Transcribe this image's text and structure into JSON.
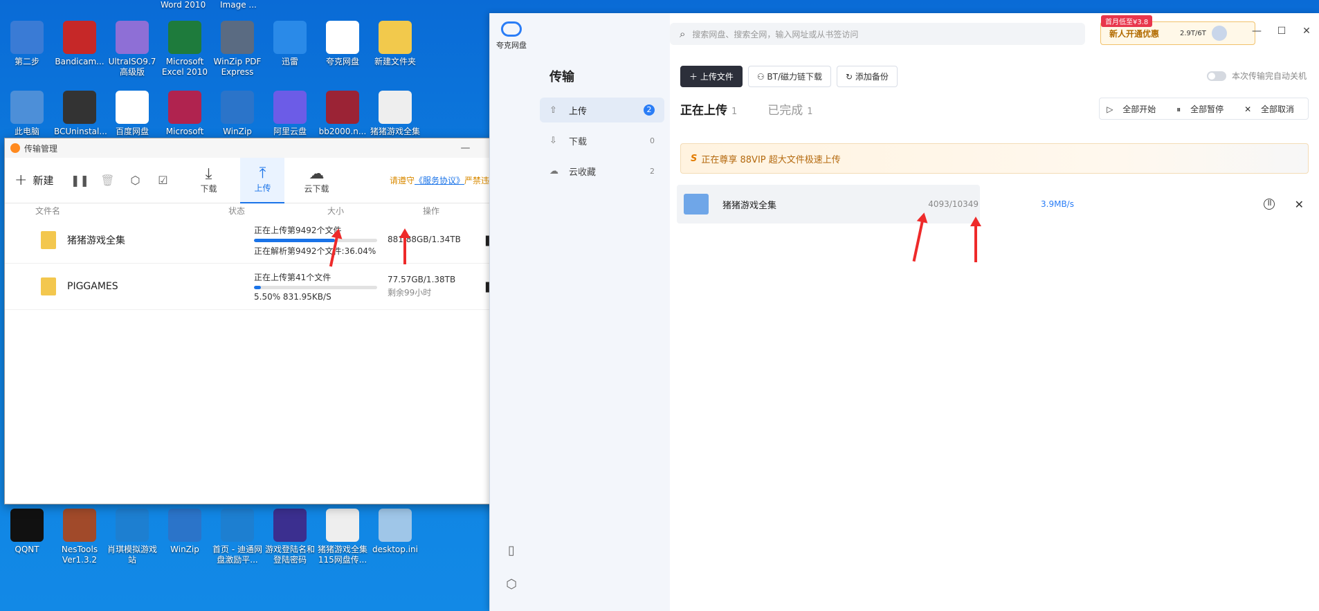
{
  "desktop": {
    "top_labels": [
      "Word 2010",
      "Image ..."
    ],
    "icons_row1": [
      {
        "label": "第二步",
        "color": "#3a7bd5"
      },
      {
        "label": "Bandicam...",
        "color": "#c62828"
      },
      {
        "label": "UltraISO9.7 高级版",
        "color": "#8e6fd6"
      },
      {
        "label": "Microsoft Excel 2010",
        "color": "#1e7b3c"
      },
      {
        "label": "WinZip PDF Express",
        "color": "#5a6b82"
      },
      {
        "label": "迅雷",
        "color": "#2a8ae8"
      },
      {
        "label": "夸克网盘",
        "color": "#ffffff"
      },
      {
        "label": "新建文件夹",
        "color": "#f2c94c"
      }
    ],
    "icons_row2": [
      {
        "label": "此电脑",
        "color": "#4d8fd8"
      },
      {
        "label": "BCUninstal...",
        "color": "#333333"
      },
      {
        "label": "百度网盘",
        "color": "#ffffff"
      },
      {
        "label": "Microsoft",
        "color": "#b0234f"
      },
      {
        "label": "WinZip",
        "color": "#2b74c9"
      },
      {
        "label": "阿里云盘",
        "color": "#6c5ce7"
      },
      {
        "label": "bb2000.n...",
        "color": "#9b2335"
      },
      {
        "label": "猪猪游戏全集",
        "color": "#eeeeee"
      }
    ],
    "icons_row3": [
      {
        "label": "QQNT",
        "color": "#111111"
      },
      {
        "label": "NesTools Ver1.3.2",
        "color": "#a14a2a"
      },
      {
        "label": "肖琪模拟游戏站",
        "color": "#1d7fd1"
      },
      {
        "label": "WinZip",
        "color": "#2b74c9"
      },
      {
        "label": "首页 - 迪通网盘激励平...",
        "color": "#1d7fd1"
      },
      {
        "label": "游戏登陆名和登陆密码",
        "color": "#3b2f8f"
      },
      {
        "label": "猪猪游戏全集115网盘传...",
        "color": "#eeeeee"
      },
      {
        "label": "desktop.ini",
        "color": "#9fc6e8"
      }
    ]
  },
  "transfer_manager": {
    "title": "传输管理",
    "new_label": "新建",
    "tabs": [
      {
        "label": "下载",
        "icon": "download-icon"
      },
      {
        "label": "上传",
        "icon": "upload-icon"
      },
      {
        "label": "云下载",
        "icon": "cloud-download-icon"
      }
    ],
    "notice_prefix": "请遵守",
    "notice_link": "《服务协议》",
    "notice_suffix": "严禁违法违规信息",
    "columns": {
      "name": "文件名",
      "status": "状态",
      "size": "大小",
      "ops": "操作"
    },
    "rows": [
      {
        "name": "猪猪游戏全集",
        "status_line1": "正在上传第9492个文件",
        "status_line2": "正在解析第9492个文件:36.04%",
        "progress": 0.66,
        "size_line1": "881.88GB/1.34TB",
        "size_line2": ""
      },
      {
        "name": "PIGGAMES",
        "status_line1": "正在上传第41个文件",
        "status_line2": "5.50%  831.95KB/S",
        "progress": 0.055,
        "size_line1": "77.57GB/1.38TB",
        "size_line2": "剩余99小时"
      }
    ]
  },
  "quark": {
    "logo_label": "夸克网盘",
    "search_placeholder": "搜索网盘、搜索全网，输入网址或从书签访问",
    "promo_badge": "首月低至¥3.8",
    "promo_text": "新人开通优惠",
    "storage": "2.9T/6T",
    "sidebar_title": "传输",
    "nav": [
      {
        "label": "上传",
        "count": "2"
      },
      {
        "label": "下载",
        "count": "0"
      },
      {
        "label": "云收藏",
        "count": "2"
      }
    ],
    "actions": {
      "upload": "上传文件",
      "bt": "BT/磁力链下载",
      "backup": "添加备份"
    },
    "auto_shutdown": "本次传输完自动关机",
    "subtabs": [
      {
        "label": "正在上传",
        "count": "1"
      },
      {
        "label": "已完成",
        "count": "1"
      }
    ],
    "bulk": {
      "start": "全部开始",
      "pause": "全部暂停",
      "cancel": "全部取消"
    },
    "vip_banner": "正在尊享 88VIP 超大文件极速上传",
    "row": {
      "name": "猪猪游戏全集",
      "progress": "4093/10349",
      "speed": "3.9MB/s"
    }
  }
}
